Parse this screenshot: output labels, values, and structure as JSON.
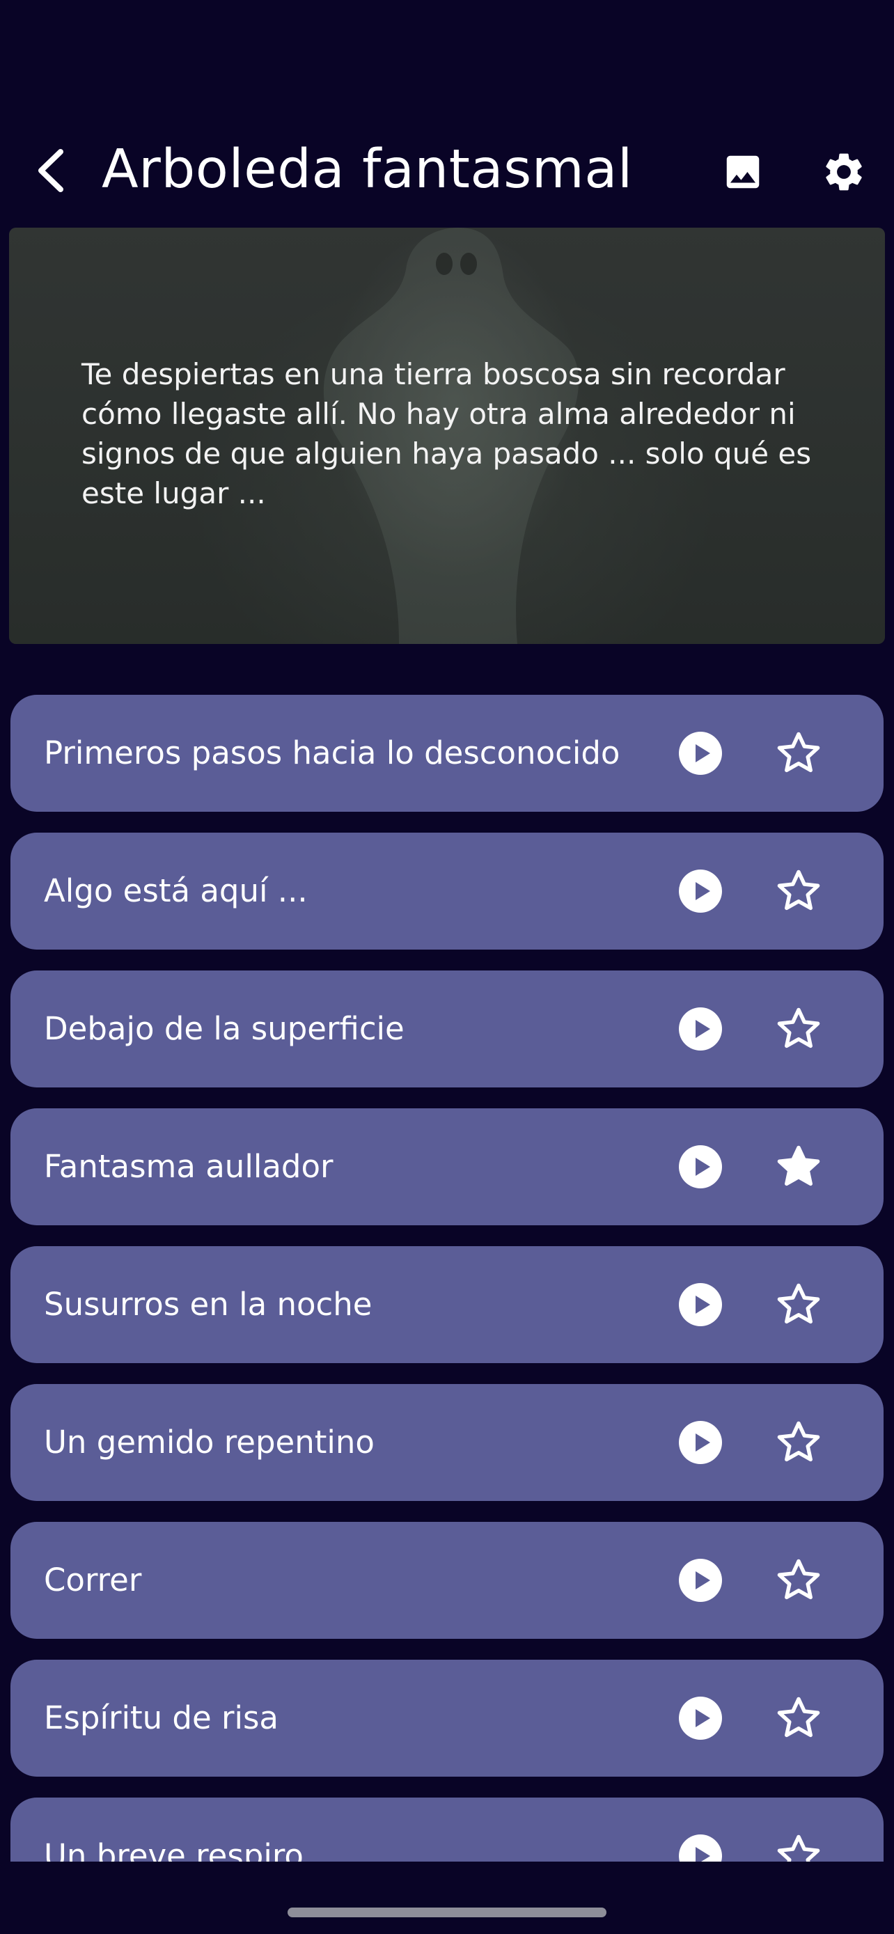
{
  "header": {
    "title": "Arboleda fantasmal",
    "back_icon": "chevron-left-icon",
    "image_icon": "image-icon",
    "settings_icon": "gear-icon"
  },
  "hero": {
    "description": "Te despiertas en una tierra boscosa sin recordar cómo llegaste allí. No hay otra alma alrededor ni signos de que alguien haya pasado ... solo qué es este lugar ..."
  },
  "chapters": [
    {
      "title": "Primeros pasos hacia lo desconocido",
      "favorite": false
    },
    {
      "title": "Algo está aquí ...",
      "favorite": false
    },
    {
      "title": "Debajo de la superficie",
      "favorite": false
    },
    {
      "title": "Fantasma aullador",
      "favorite": true
    },
    {
      "title": "Susurros en la noche",
      "favorite": false
    },
    {
      "title": "Un gemido repentino",
      "favorite": false
    },
    {
      "title": "Correr",
      "favorite": false
    },
    {
      "title": "Espíritu de risa",
      "favorite": false
    },
    {
      "title": "Un breve respiro",
      "favorite": false
    }
  ],
  "colors": {
    "background": "#090426",
    "card": "#5b5d97",
    "text": "#ffffff"
  }
}
